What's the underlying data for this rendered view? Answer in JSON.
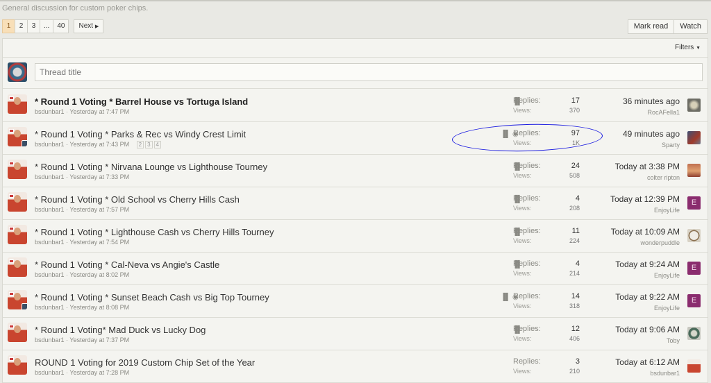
{
  "forum_description": "General discussion for custom poker chips.",
  "pagination": {
    "pages": [
      "1",
      "2",
      "3",
      "...",
      "40"
    ],
    "next_label": "Next"
  },
  "actions": {
    "mark_read": "Mark read",
    "watch": "Watch"
  },
  "filters_label": "Filters",
  "new_thread": {
    "placeholder": "Thread title"
  },
  "threads": [
    {
      "title": "* Round 1 Voting * Barrel House vs Tortuga Island",
      "author": "bsdunbar1",
      "started": "Yesterday at 7:47 PM",
      "replies_label": "Replies:",
      "replies": "17",
      "views_label": "Views:",
      "views": "370",
      "last_time": "36 minutes ago",
      "last_user": "RocAFella1"
    },
    {
      "title": "* Round 1 Voting * Parks & Rec vs Windy Crest Limit",
      "author": "bsdunbar1",
      "started": "Yesterday at 7:43 PM",
      "pages": [
        "2",
        "3",
        "4"
      ],
      "replies_label": "Replies:",
      "replies": "97",
      "views_label": "Views:",
      "views": "1K",
      "last_time": "49 minutes ago",
      "last_user": "Sparty"
    },
    {
      "title": "* Round 1 Voting * Nirvana Lounge vs Lighthouse Tourney",
      "author": "bsdunbar1",
      "started": "Yesterday at 7:33 PM",
      "replies_label": "Replies:",
      "replies": "24",
      "views_label": "Views:",
      "views": "508",
      "last_time": "Today at 3:38 PM",
      "last_user": "colter ripton"
    },
    {
      "title": "* Round 1 Voting * Old School vs Cherry Hills Cash",
      "author": "bsdunbar1",
      "started": "Yesterday at 7:57 PM",
      "replies_label": "Replies:",
      "replies": "4",
      "views_label": "Views:",
      "views": "208",
      "last_time": "Today at 12:39 PM",
      "last_user": "EnjoyLife",
      "last_avatar_letter": "E"
    },
    {
      "title": "* Round 1 Voting * Lighthouse Cash vs Cherry Hills Tourney",
      "author": "bsdunbar1",
      "started": "Yesterday at 7:54 PM",
      "replies_label": "Replies:",
      "replies": "11",
      "views_label": "Views:",
      "views": "224",
      "last_time": "Today at 10:09 AM",
      "last_user": "wonderpuddle"
    },
    {
      "title": "* Round 1 Voting * Cal-Neva vs Angie's Castle",
      "author": "bsdunbar1",
      "started": "Yesterday at 8:02 PM",
      "replies_label": "Replies:",
      "replies": "4",
      "views_label": "Views:",
      "views": "214",
      "last_time": "Today at 9:24 AM",
      "last_user": "EnjoyLife",
      "last_avatar_letter": "E"
    },
    {
      "title": "* Round 1 Voting * Sunset Beach Cash vs Big Top Tourney",
      "author": "bsdunbar1",
      "started": "Yesterday at 8:08 PM",
      "replies_label": "Replies:",
      "replies": "14",
      "views_label": "Views:",
      "views": "318",
      "last_time": "Today at 9:22 AM",
      "last_user": "EnjoyLife",
      "last_avatar_letter": "E"
    },
    {
      "title": "* Round 1 Voting* Mad Duck vs Lucky Dog",
      "author": "bsdunbar1",
      "started": "Yesterday at 7:37 PM",
      "replies_label": "Replies:",
      "replies": "12",
      "views_label": "Views:",
      "views": "406",
      "last_time": "Today at 9:06 AM",
      "last_user": "Toby"
    },
    {
      "title": "ROUND 1 Voting for 2019 Custom Chip Set of the Year",
      "author": "bsdunbar1",
      "started": "Yesterday at 7:28 PM",
      "replies_label": "Replies:",
      "replies": "3",
      "views_label": "Views:",
      "views": "210",
      "last_time": "Today at 6:12 AM",
      "last_user": "bsdunbar1"
    }
  ],
  "icons": {
    "poll": "bar-chart-icon",
    "watched": "eye-icon",
    "filters_caret": "caret-down-icon",
    "next_caret": "caret-right-icon"
  }
}
